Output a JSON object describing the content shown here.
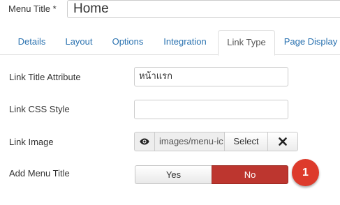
{
  "menu_title": {
    "label": "Menu Title *",
    "value": "Home"
  },
  "tabs": [
    {
      "label": "Details",
      "active": false
    },
    {
      "label": "Layout",
      "active": false
    },
    {
      "label": "Options",
      "active": false
    },
    {
      "label": "Integration",
      "active": false
    },
    {
      "label": "Link Type",
      "active": true
    },
    {
      "label": "Page Display",
      "active": false
    }
  ],
  "fields": {
    "link_title_attribute": {
      "label": "Link Title Attribute",
      "value": "หน้าแรก"
    },
    "link_css_style": {
      "label": "Link CSS Style",
      "value": ""
    },
    "link_image": {
      "label": "Link Image",
      "path": "images/menu-ic",
      "select_label": "Select",
      "preview_icon": "eye-icon",
      "clear_icon": "close-icon"
    },
    "add_menu_title": {
      "label": "Add Menu Title",
      "yes_label": "Yes",
      "no_label": "No",
      "selected": "No"
    }
  },
  "annotation": {
    "number": "1",
    "color": "#dd3b2c"
  },
  "colors": {
    "tab_link": "#2a72b0",
    "no_active": "#bd362f"
  }
}
